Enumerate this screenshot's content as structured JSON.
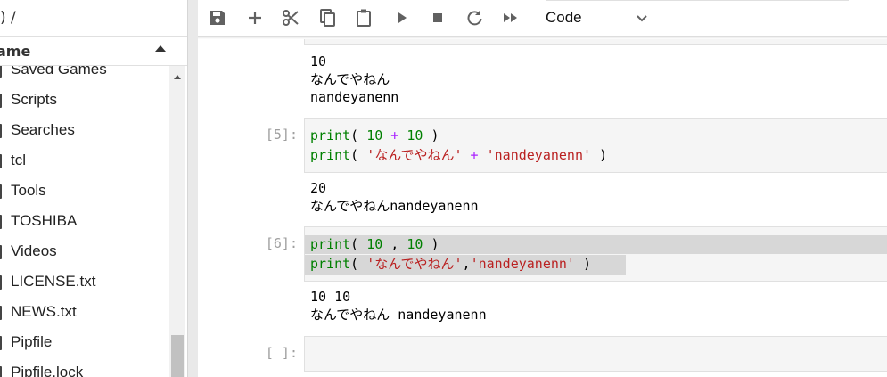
{
  "file_browser": {
    "path": ") /",
    "column_header": "ame",
    "items": [
      {
        "label": "Saved Games"
      },
      {
        "label": "Scripts"
      },
      {
        "label": "Searches"
      },
      {
        "label": "tcl"
      },
      {
        "label": "Tools"
      },
      {
        "label": "TOSHIBA"
      },
      {
        "label": "Videos"
      },
      {
        "label": "LICENSE.txt"
      },
      {
        "label": "NEWS.txt"
      },
      {
        "label": "Pipfile"
      },
      {
        "label": "Pipfile.lock"
      }
    ]
  },
  "toolbar": {
    "icons": [
      "save-icon",
      "add-icon",
      "cut-icon",
      "copy-icon",
      "paste-icon",
      "run-icon",
      "stop-icon",
      "restart-icon",
      "run-all-icon"
    ],
    "cell_type": "Code"
  },
  "notebook": {
    "output_top": [
      "10",
      "なんでやねん",
      "nandeyanenn"
    ],
    "cell5": {
      "prompt": "[5]:",
      "line1": {
        "a": "print",
        "b": "( ",
        "c": "10",
        "d": " + ",
        "e": "10",
        "f": " )"
      },
      "line2": {
        "a": "print",
        "b": "( ",
        "c": "'なんでやねん'",
        "d": " + ",
        "e": "'nandeyanenn'",
        "f": " )"
      },
      "output": [
        "20",
        "なんでやねんnandeyanenn"
      ]
    },
    "cell6": {
      "prompt": "[6]:",
      "line1": {
        "a": "print",
        "b": "( ",
        "c": "10",
        "d": " , ",
        "e": "10",
        "f": " )"
      },
      "line2": {
        "a": "print",
        "b": "( ",
        "c": "'なんでやねん'",
        "d": ",",
        "e": "'nandeyanenn'",
        "f": " )"
      },
      "output": [
        "10 10",
        "なんでやねん nandeyanenn"
      ]
    },
    "cell_empty": {
      "prompt": "[ ]:"
    }
  },
  "colors": {
    "keyword": "#008000",
    "number": "#008000",
    "operator": "#aa22ff",
    "string": "#ba2121",
    "prompt": "#9e9e9e"
  }
}
